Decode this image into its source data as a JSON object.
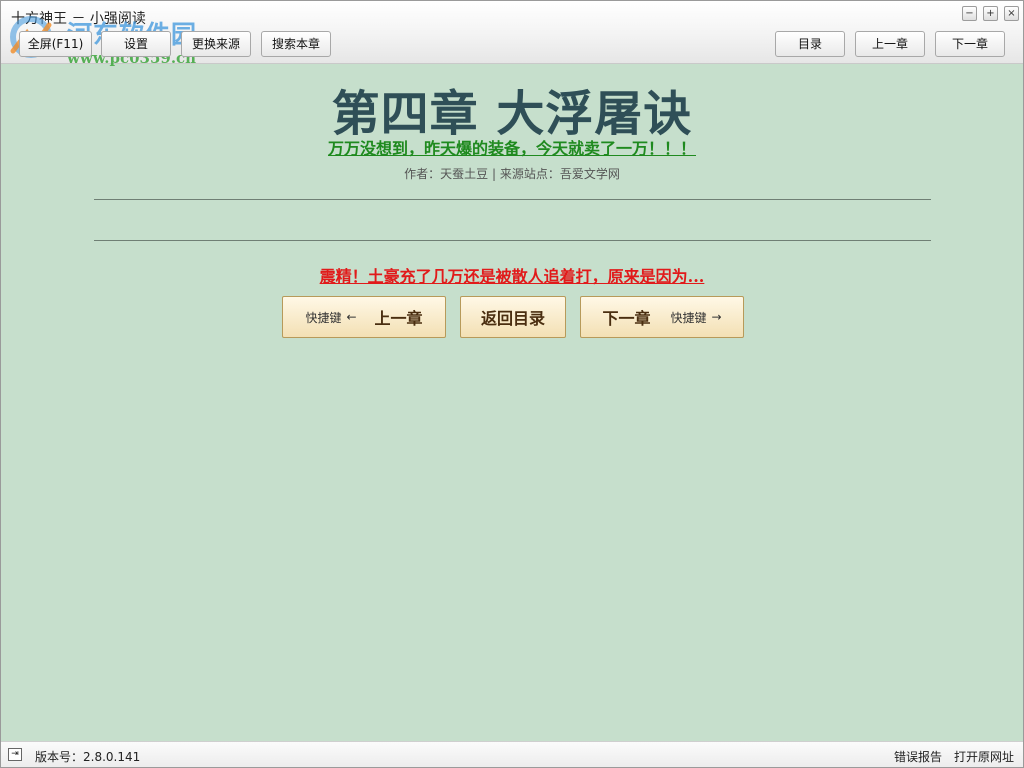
{
  "window": {
    "title": "十方神王 － 小强阅读",
    "controls": {
      "minimize": "−",
      "maximize": "+",
      "close": "×"
    }
  },
  "watermark": {
    "name": "河东软件园",
    "url": "www.pc0359.cn"
  },
  "toolbar": {
    "fullscreen": "全屏(F11)",
    "settings": "设置",
    "change_source": "更换来源",
    "search_chapter": "搜索本章",
    "catalog": "目录",
    "prev_chapter": "上一章",
    "next_chapter": "下一章"
  },
  "chapter": {
    "title": "第四章 大浮屠诀",
    "ad_top": "万万没想到，昨天爆的装备，今天就卖了一万！！！",
    "meta": "作者：天蚕土豆 | 来源站点：吾爱文学网",
    "ad_bottom": "震精！土豪充了几万还是被散人追着打，原来是因为..."
  },
  "nav": {
    "shortcut_label": "快捷键",
    "left_arrow": "←",
    "right_arrow": "→",
    "prev": "上一章",
    "back": "返回目录",
    "next": "下一章"
  },
  "status": {
    "icon": "exit-icon",
    "version": "版本号：2.8.0.141",
    "error_report": "错误报告",
    "open_source_url": "打开原网址"
  },
  "colors": {
    "background": "#c6dfcc",
    "title": "#2f4f57",
    "ad_top": "#1f8a1f",
    "ad_bottom": "#e11a1a",
    "nav_button": "#f3e0b4"
  }
}
